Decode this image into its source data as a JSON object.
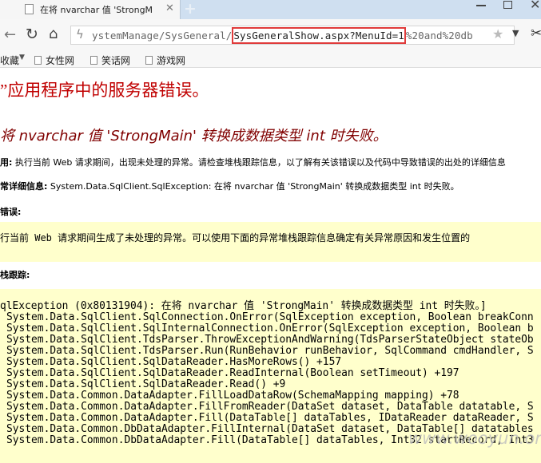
{
  "tab": {
    "title": "在将 nvarchar 值 'StrongM"
  },
  "address_bar": {
    "url_prefix": "ystemManage/SysGeneral/",
    "url_highlight": "SysGeneralShow.aspx?MenuId=1",
    "url_suffix": "%20and%20db"
  },
  "bookmarks": {
    "favorites_label": "收藏",
    "items": [
      "女性网",
      "笑话网",
      "游戏网"
    ]
  },
  "page": {
    "title": "”应用程序中的服务器错误。",
    "subtitle": "将 nvarchar 值 'StrongMain' 转换成数据类型 int 时失败。",
    "desc_label": "用:",
    "desc_text": " 执行当前 Web 请求期间，出现未处理的异常。请检查堆栈跟踪信息，以了解有关该错误以及代码中导致错误的出处的详细信息",
    "exception_label": "常详细信息:",
    "exception_text": " System.Data.SqlClient.SqlException: 在将 nvarchar 值 'StrongMain' 转换成数据类型 int 时失败。",
    "source_label": "错误:",
    "source_text": "行当前 Web 请求期间生成了未处理的异常。可以使用下面的异常堆栈跟踪信息确定有关异常原因和发生位置的",
    "stack_label": "栈跟踪:",
    "stack_lines": [
      "qlException (0x80131904): 在将 nvarchar 值 'StrongMain' 转换成数据类型 int 时失败。]",
      "System.Data.SqlClient.SqlConnection.OnError(SqlException exception, Boolean breakConn",
      "System.Data.SqlClient.SqlInternalConnection.OnError(SqlException exception, Boolean b",
      "System.Data.SqlClient.TdsParser.ThrowExceptionAndWarning(TdsParserStateObject stateOb",
      "System.Data.SqlClient.TdsParser.Run(RunBehavior runBehavior, SqlCommand cmdHandler, S",
      "System.Data.SqlClient.SqlDataReader.HasMoreRows() +157",
      "System.Data.SqlClient.SqlDataReader.ReadInternal(Boolean setTimeout) +197",
      "System.Data.SqlClient.SqlDataReader.Read() +9",
      "System.Data.Common.DataAdapter.FillLoadDataRow(SchemaMapping mapping) +78",
      "System.Data.Common.DataAdapter.FillFromReader(DataSet dataset, DataTable datatable, S",
      "System.Data.Common.DataAdapter.Fill(DataTable[] dataTables, IDataReader dataReader, S",
      "System.Data.Common.DbDataAdapter.FillInternal(DataSet dataset, DataTable[] datatables",
      "System.Data.Common.DbDataAdapter.Fill(DataTable[] dataTables, Int32 startRecord, Int3"
    ]
  },
  "watermark": "www.wooyun.org"
}
